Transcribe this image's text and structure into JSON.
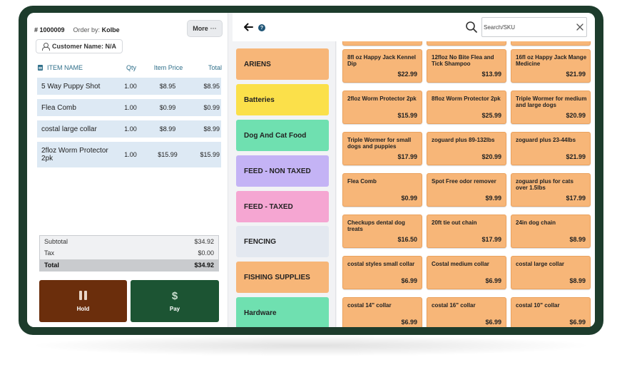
{
  "order": {
    "number": "# 1000009",
    "order_by_label": "Order by:",
    "order_by_name": "Kolbe",
    "more_label": "More",
    "more_icon": "···",
    "customer_label": "Customer Name: N/A"
  },
  "items_table": {
    "headers": [
      "ITEM NAME",
      "Qty",
      "Item Price",
      "Total"
    ],
    "rows": [
      {
        "name": "5 Way Puppy Shot",
        "qty": "1.00",
        "price": "$8.95",
        "total": "$8.95"
      },
      {
        "name": "Flea Comb",
        "qty": "1.00",
        "price": "$0.99",
        "total": "$0.99"
      },
      {
        "name": "costal large collar",
        "qty": "1.00",
        "price": "$8.99",
        "total": "$8.99"
      },
      {
        "name": "2floz Worm Protector 2pk",
        "qty": "1.00",
        "price": "$15.99",
        "total": "$15.99"
      }
    ]
  },
  "totals": {
    "subtotal_label": "Subtotal",
    "subtotal": "$34.92",
    "tax_label": "Tax",
    "tax": "$0.00",
    "total_label": "Total",
    "total": "$34.92"
  },
  "actions": {
    "hold_label": "Hold",
    "hold_color": "#6b2e0c",
    "pay_label": "Pay",
    "pay_icon": "$",
    "pay_color": "#1c5433"
  },
  "search": {
    "placeholder": "Search/SKU",
    "value": ""
  },
  "help_icon": "?",
  "categories": [
    {
      "label": "ARIENS",
      "color": "#f7b678"
    },
    {
      "label": "Batteries",
      "color": "#fbe04a"
    },
    {
      "label": "Dog And Cat Food",
      "color": "#6fe0b0"
    },
    {
      "label": "FEED - NON TAXED",
      "color": "#c4b3f5"
    },
    {
      "label": "FEED - TAXED",
      "color": "#f5a6d2"
    },
    {
      "label": "FENCING",
      "color": "#e3e8f0"
    },
    {
      "label": "FISHING SUPPLIES",
      "color": "#f7b678"
    },
    {
      "label": "Hardware",
      "color": "#6fe0b0"
    }
  ],
  "products": [
    {
      "name": "8fl oz Happy Jack Kennel Dip",
      "price": "$22.99"
    },
    {
      "name": "12floz No Bite Flea and Tick Shampoo",
      "price": "$13.99"
    },
    {
      "name": "16fl oz Happy Jack Mange Medicine",
      "price": "$21.99"
    },
    {
      "name": "2floz Worm Protector 2pk",
      "price": "$15.99"
    },
    {
      "name": "8floz Worm Protector 2pk",
      "price": "$25.99"
    },
    {
      "name": "Triple Wormer for medium and large dogs",
      "price": "$20.99"
    },
    {
      "name": "Triple Wormer for small dogs and puppies",
      "price": "$17.99"
    },
    {
      "name": "zoguard plus 89-132lbs",
      "price": "$20.99"
    },
    {
      "name": "zoguard plus 23-44lbs",
      "price": "$21.99"
    },
    {
      "name": "Flea Comb",
      "price": "$0.99"
    },
    {
      "name": "Spot Free odor remover",
      "price": "$9.99"
    },
    {
      "name": "zoguard plus for cats over 1.5lbs",
      "price": "$17.99"
    },
    {
      "name": "Checkups dental dog treats",
      "price": "$16.50"
    },
    {
      "name": "20ft tie out chain",
      "price": "$17.99"
    },
    {
      "name": "24in dog chain",
      "price": "$8.99"
    },
    {
      "name": "costal styles small collar",
      "price": "$6.99"
    },
    {
      "name": "Costal medium collar",
      "price": "$6.99"
    },
    {
      "name": "costal large collar",
      "price": "$8.99"
    },
    {
      "name": "costal 14\" collar",
      "price": "$6.99"
    },
    {
      "name": "costal 16\" collar",
      "price": "$6.99"
    },
    {
      "name": "costal 10\" collar",
      "price": "$6.99"
    }
  ]
}
